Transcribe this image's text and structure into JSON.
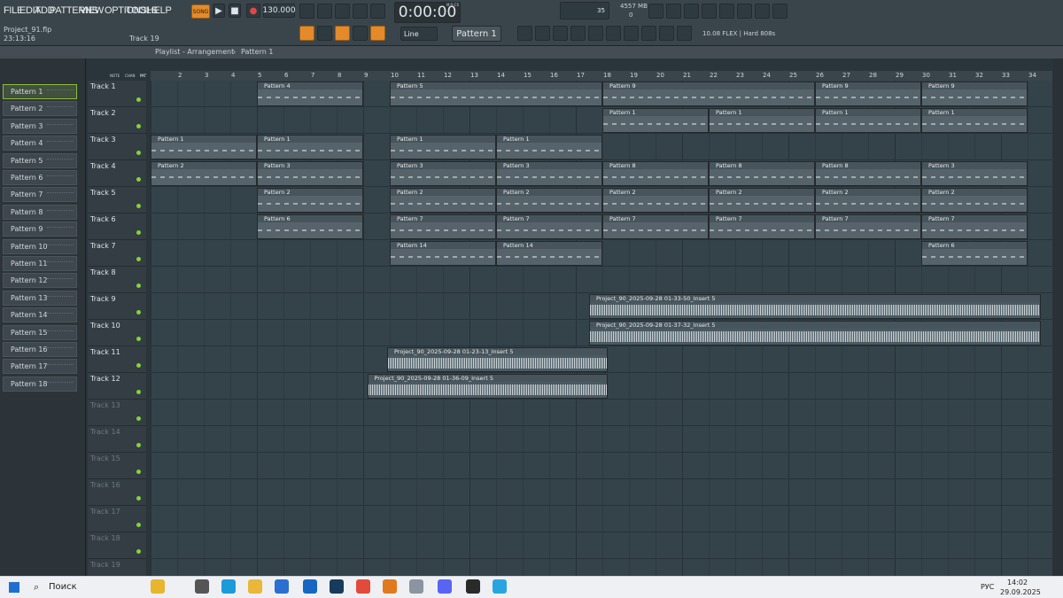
{
  "menu": [
    "FILE",
    "EDIT",
    "ADD",
    "PATTERNS",
    "VIEW",
    "OPTIONS",
    "TOOLS",
    "HELP"
  ],
  "transport": {
    "mode": "SONG",
    "tempo": "130.000",
    "time": "0:00:00",
    "time_unit": "M:S:CS",
    "cpu": "35",
    "ram": "4557 MB",
    "voices": "0"
  },
  "project": {
    "file": "Project_91.flp",
    "time": "23:13:16",
    "hint": "Track 19"
  },
  "snap": "Line",
  "pattern_selector": "Pattern 1",
  "plugin_hint": "10.08 FLEX | Hard 808s",
  "playlist": {
    "title": "Playlist - Arrangement",
    "sep": "›",
    "pattern": "Pattern 1"
  },
  "browser_tabs": [
    "NOTE",
    "CHAN",
    "PAT"
  ],
  "patterns": [
    "Pattern 1",
    "Pattern 2",
    "Pattern 3",
    "Pattern 4",
    "Pattern 5",
    "Pattern 6",
    "Pattern 7",
    "Pattern 8",
    "Pattern 9",
    "Pattern 10",
    "Pattern 11",
    "Pattern 12",
    "Pattern 13",
    "Pattern 14",
    "Pattern 15",
    "Pattern 16",
    "Pattern 17",
    "Pattern 18"
  ],
  "bars": [
    "2",
    "3",
    "4",
    "5",
    "6",
    "7",
    "8",
    "9",
    "10",
    "11",
    "12",
    "13",
    "14",
    "15",
    "16",
    "17",
    "18",
    "19",
    "20",
    "21",
    "22",
    "23",
    "24",
    "25",
    "26",
    "27",
    "28",
    "29",
    "30",
    "31",
    "32",
    "33",
    "34"
  ],
  "tracks": [
    "Track 1",
    "Track 2",
    "Track 3",
    "Track 4",
    "Track 5",
    "Track 6",
    "Track 7",
    "Track 8",
    "Track 9",
    "Track 10",
    "Track 11",
    "Track 12",
    "Track 13",
    "Track 14",
    "Track 15",
    "Track 16",
    "Track 17",
    "Track 18",
    "Track 19"
  ],
  "clips": [
    {
      "t": 0,
      "s": 5,
      "e": 9,
      "n": "Pattern 4"
    },
    {
      "t": 0,
      "s": 10,
      "e": 18,
      "n": "Pattern 5"
    },
    {
      "t": 0,
      "s": 18,
      "e": 26,
      "n": "Pattern 9"
    },
    {
      "t": 0,
      "s": 26,
      "e": 30,
      "n": "Pattern 9"
    },
    {
      "t": 0,
      "s": 30,
      "e": 34,
      "n": "Pattern 9"
    },
    {
      "t": 1,
      "s": 18,
      "e": 22,
      "n": "Pattern 1"
    },
    {
      "t": 1,
      "s": 22,
      "e": 26,
      "n": "Pattern 1"
    },
    {
      "t": 1,
      "s": 26,
      "e": 30,
      "n": "Pattern 1"
    },
    {
      "t": 1,
      "s": 30,
      "e": 34,
      "n": "Pattern 1"
    },
    {
      "t": 2,
      "s": 1,
      "e": 5,
      "n": "Pattern 1"
    },
    {
      "t": 2,
      "s": 5,
      "e": 9,
      "n": "Pattern 1"
    },
    {
      "t": 2,
      "s": 10,
      "e": 14,
      "n": "Pattern 1"
    },
    {
      "t": 2,
      "s": 14,
      "e": 18,
      "n": "Pattern 1"
    },
    {
      "t": 3,
      "s": 1,
      "e": 5,
      "n": "Pattern 2"
    },
    {
      "t": 3,
      "s": 5,
      "e": 9,
      "n": "Pattern 3"
    },
    {
      "t": 3,
      "s": 10,
      "e": 14,
      "n": "Pattern 3"
    },
    {
      "t": 3,
      "s": 14,
      "e": 18,
      "n": "Pattern 3"
    },
    {
      "t": 3,
      "s": 18,
      "e": 22,
      "n": "Pattern 8"
    },
    {
      "t": 3,
      "s": 22,
      "e": 26,
      "n": "Pattern 8"
    },
    {
      "t": 3,
      "s": 26,
      "e": 30,
      "n": "Pattern 8"
    },
    {
      "t": 3,
      "s": 30,
      "e": 34,
      "n": "Pattern 3"
    },
    {
      "t": 4,
      "s": 5,
      "e": 9,
      "n": "Pattern 2"
    },
    {
      "t": 4,
      "s": 10,
      "e": 14,
      "n": "Pattern 2"
    },
    {
      "t": 4,
      "s": 14,
      "e": 18,
      "n": "Pattern 2"
    },
    {
      "t": 4,
      "s": 18,
      "e": 22,
      "n": "Pattern 2"
    },
    {
      "t": 4,
      "s": 22,
      "e": 26,
      "n": "Pattern 2"
    },
    {
      "t": 4,
      "s": 26,
      "e": 30,
      "n": "Pattern 2"
    },
    {
      "t": 4,
      "s": 30,
      "e": 34,
      "n": "Pattern 2"
    },
    {
      "t": 5,
      "s": 5,
      "e": 9,
      "n": "Pattern 6"
    },
    {
      "t": 5,
      "s": 10,
      "e": 14,
      "n": "Pattern 7"
    },
    {
      "t": 5,
      "s": 14,
      "e": 18,
      "n": "Pattern 7"
    },
    {
      "t": 5,
      "s": 18,
      "e": 22,
      "n": "Pattern 7"
    },
    {
      "t": 5,
      "s": 22,
      "e": 26,
      "n": "Pattern 7"
    },
    {
      "t": 5,
      "s": 26,
      "e": 30,
      "n": "Pattern 7"
    },
    {
      "t": 5,
      "s": 30,
      "e": 34,
      "n": "Pattern 7"
    },
    {
      "t": 6,
      "s": 10,
      "e": 14,
      "n": "Pattern 14"
    },
    {
      "t": 6,
      "s": 14,
      "e": 18,
      "n": "Pattern 14"
    },
    {
      "t": 6,
      "s": 30,
      "e": 34,
      "n": "Pattern 6"
    }
  ],
  "audio": [
    {
      "t": 8,
      "s": 17.5,
      "e": 34.5,
      "n": "Project_90_2025-09-28 01-33-50_Insert 5"
    },
    {
      "t": 9,
      "s": 17.5,
      "e": 34.5,
      "n": "Project_90_2025-09-28 01-37-32_Insert 5"
    },
    {
      "t": 10,
      "s": 9.9,
      "e": 18.2,
      "n": "Project_90_2025-09-28 01-23-13_Insert 5"
    },
    {
      "t": 11,
      "s": 9.15,
      "e": 18.2,
      "n": "Project_90_2025-09-28 01-36-09_Insert 5"
    }
  ],
  "taskbar": {
    "search": "Поиск",
    "lang": "РУС",
    "clock": "14:02",
    "date": "29.09.2025"
  }
}
